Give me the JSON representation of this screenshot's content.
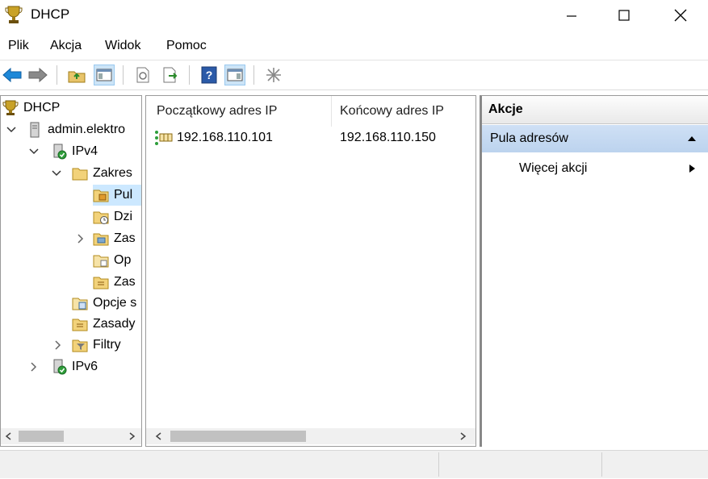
{
  "window": {
    "title": "DHCP",
    "minimize_glyph": "—",
    "maximize_glyph": "☐",
    "close_glyph": "✕"
  },
  "menu": {
    "items": [
      "Plik",
      "Akcja",
      "Widok",
      "Pomoc"
    ]
  },
  "toolbar": {
    "icons": [
      "back-arrow-icon",
      "forward-arrow-icon",
      "up-folder-icon",
      "show-hide-console-tree-icon",
      "refresh-icon",
      "export-list-icon",
      "help-icon",
      "show-hide-action-pane-icon",
      "asterisk-icon"
    ]
  },
  "tree": {
    "items": [
      {
        "label": "DHCP",
        "icon": "dhcp-trophy-icon"
      },
      {
        "label": "admin.elektro",
        "icon": "server-icon",
        "expanded": true
      },
      {
        "label": "IPv4",
        "icon": "ipv4-icon",
        "expanded": true
      },
      {
        "label": "Zakres",
        "icon": "folder-icon",
        "expanded": true
      },
      {
        "label": "Pul",
        "icon": "address-pool-icon",
        "selected": true
      },
      {
        "label": "Dzi",
        "icon": "leases-icon"
      },
      {
        "label": "Zas",
        "icon": "reservations-icon",
        "expandable": true
      },
      {
        "label": "Op",
        "icon": "scope-options-icon"
      },
      {
        "label": "Zas",
        "icon": "policies-icon"
      },
      {
        "label": "Opcje s",
        "icon": "server-options-icon"
      },
      {
        "label": "Zasady",
        "icon": "policies-icon"
      },
      {
        "label": "Filtry",
        "icon": "filter-icon",
        "expandable": true
      },
      {
        "label": "IPv6",
        "icon": "ipv6-icon",
        "expandable": true
      }
    ]
  },
  "list": {
    "columns": [
      "Początkowy adres IP",
      "Końcowy adres IP"
    ],
    "rows": [
      {
        "start": "192.168.110.101",
        "end": "192.168.110.150"
      }
    ]
  },
  "actions": {
    "title": "Akcje",
    "section": "Pula adresów",
    "items": [
      "Więcej akcji"
    ]
  },
  "colors": {
    "selection": "#cce8ff",
    "action_section": "#bcd3ee",
    "back_arrow": "#1e88d8",
    "forward_arrow": "#8a8a8a"
  }
}
